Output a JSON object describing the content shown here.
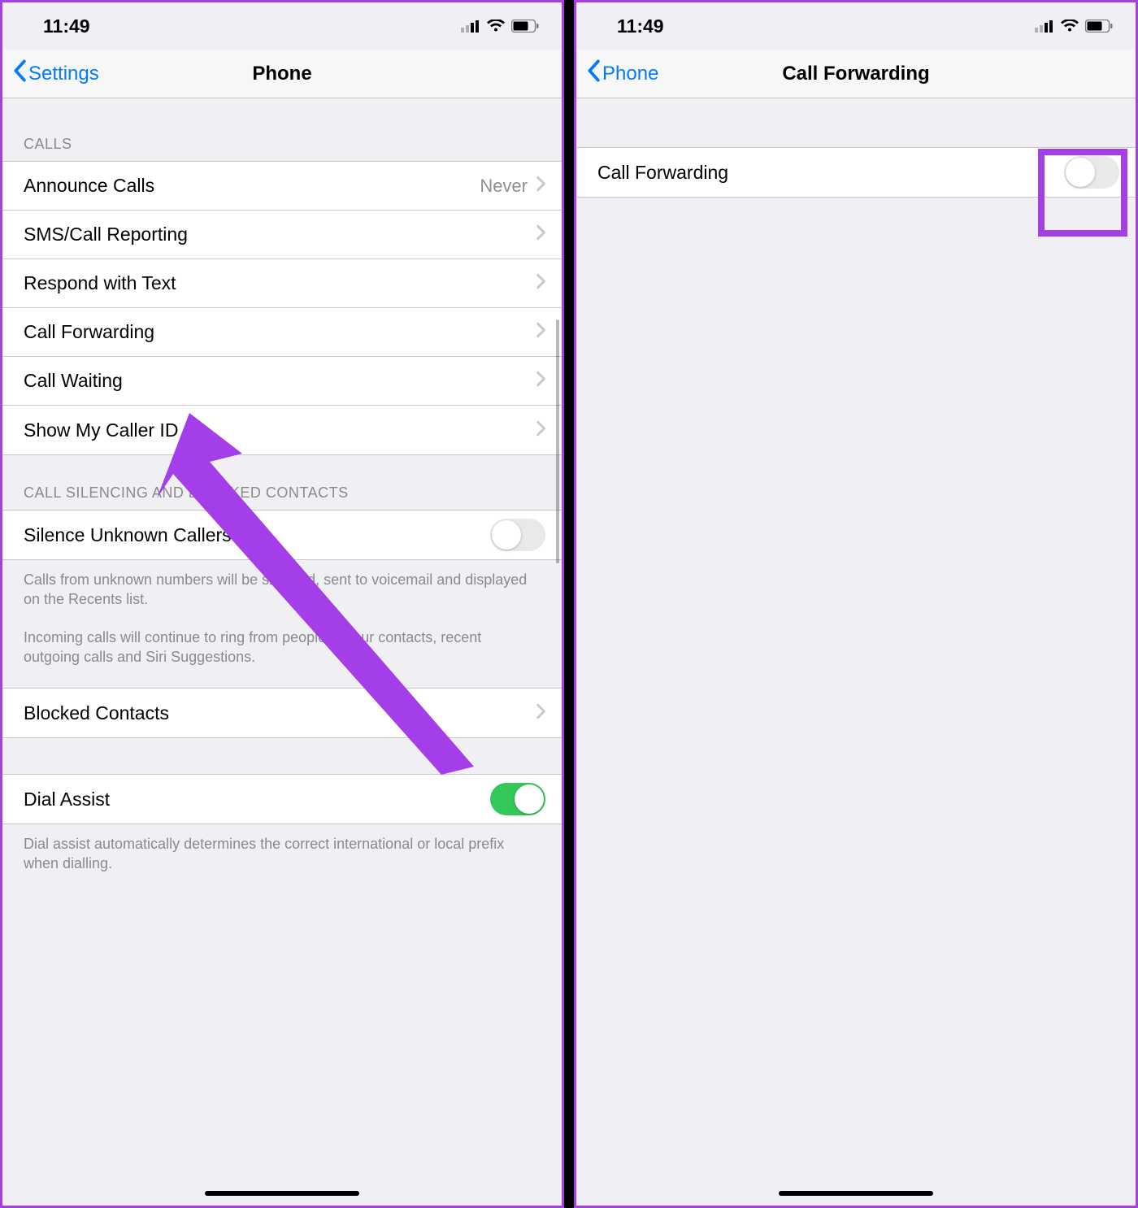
{
  "status": {
    "time": "11:49"
  },
  "left": {
    "back_label": "Settings",
    "title": "Phone",
    "sections": {
      "calls_header": "CALLS",
      "calls_items": [
        {
          "label": "Announce Calls",
          "value": "Never"
        },
        {
          "label": "SMS/Call Reporting"
        },
        {
          "label": "Respond with Text"
        },
        {
          "label": "Call Forwarding"
        },
        {
          "label": "Call Waiting"
        },
        {
          "label": "Show My Caller ID"
        }
      ],
      "silencing_header": "CALL SILENCING AND BLOCKED CONTACTS",
      "silence_unknown_label": "Silence Unknown Callers",
      "silence_footer_1": "Calls from unknown numbers will be silenced, sent to voicemail and displayed on the Recents list.",
      "silence_footer_2": "Incoming calls will continue to ring from people in your contacts, recent outgoing calls and Siri Suggestions.",
      "blocked_label": "Blocked Contacts",
      "dial_assist_label": "Dial Assist",
      "dial_assist_footer": "Dial assist automatically determines the correct international or local prefix when dialling."
    }
  },
  "right": {
    "back_label": "Phone",
    "title": "Call Forwarding",
    "row_label": "Call Forwarding"
  },
  "toggles": {
    "silence_unknown": false,
    "dial_assist": true,
    "call_forwarding": false
  },
  "colors": {
    "ios_blue": "#007aff",
    "ios_green": "#34c759",
    "annotation_purple": "#a33ee8"
  }
}
